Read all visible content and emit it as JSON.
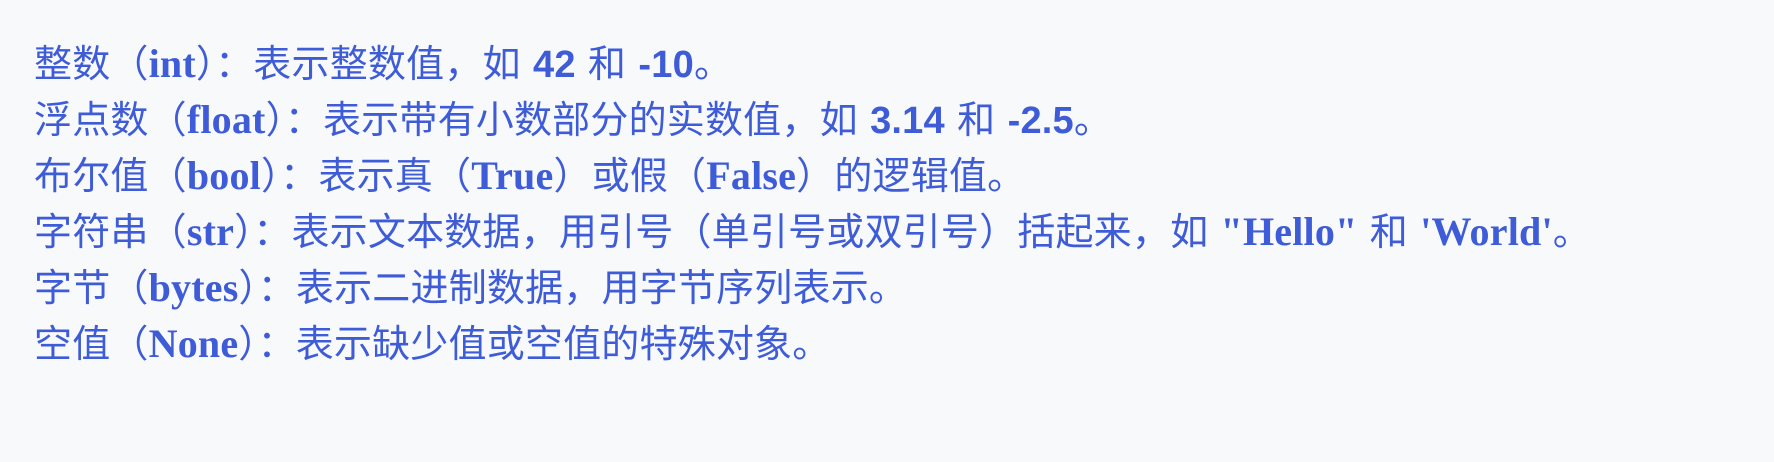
{
  "lines": [
    {
      "p1": "整数（",
      "code": "int",
      "p2": "）：表示整数值，如 ",
      "n1": "42",
      "p3": " 和 ",
      "n2": "-10",
      "p4": "。"
    },
    {
      "p1": "浮点数（",
      "code": "float",
      "p2": "）：表示带有小数部分的实数值，如 ",
      "n1": "3.14",
      "p3": " 和 ",
      "n2": "-2.5",
      "p4": "。"
    },
    {
      "p1": "布尔值（",
      "code": "bool",
      "p2": "）：表示真（",
      "c2": "True",
      "p3": "）或假（",
      "c3": "False",
      "p4": "）的逻辑值。"
    },
    {
      "p1": "字符串（",
      "code": "str",
      "p2": "）：表示文本数据，用引号（单引号或双引号）括起来，如 ",
      "c2": "\"Hello\"",
      "p3": " 和 ",
      "c3": "'World'",
      "p4": "。"
    },
    {
      "p1": "字节（",
      "code": "bytes",
      "p2": "）：表示二进制数据，用字节序列表示。"
    },
    {
      "p1": "空值（",
      "code": "None",
      "p2": "）：表示缺少值或空值的特殊对象。"
    }
  ]
}
